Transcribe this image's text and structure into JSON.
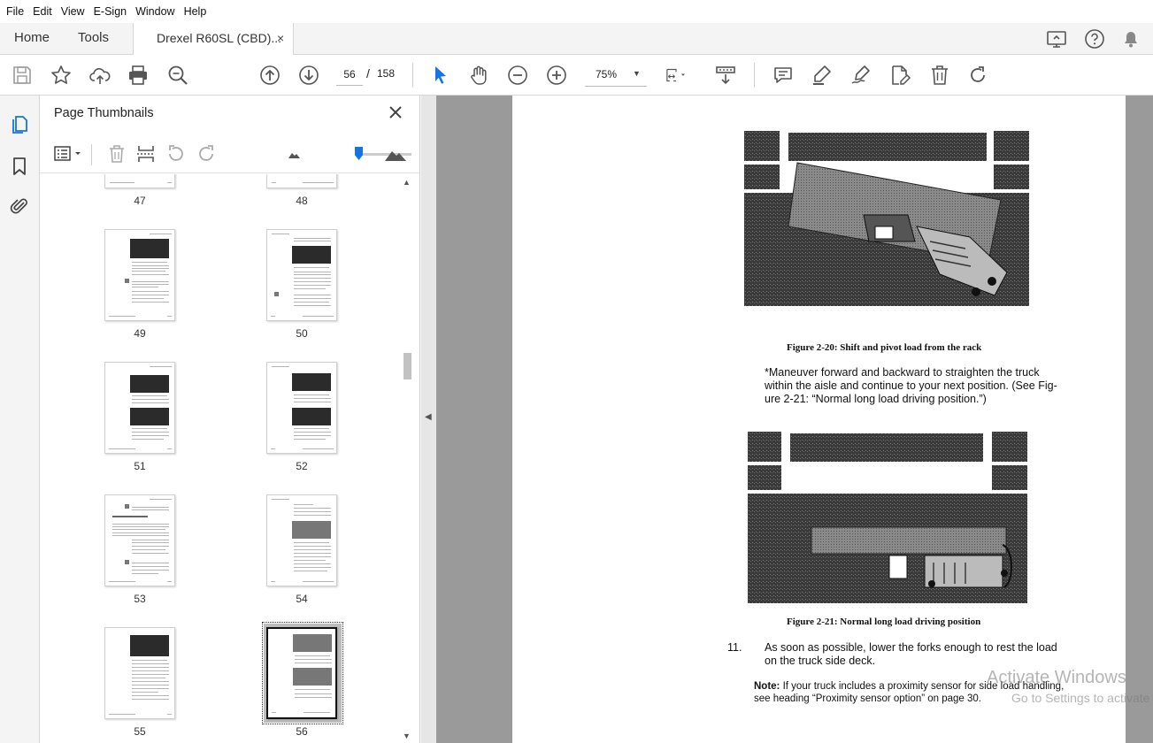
{
  "menu": [
    "File",
    "Edit",
    "View",
    "E-Sign",
    "Window",
    "Help"
  ],
  "tabs": {
    "home": "Home",
    "tools": "Tools",
    "document": "Drexel R60SL (CBD)...",
    "close": "×"
  },
  "toolbar": {
    "page_current": "56",
    "page_separator": "/",
    "page_total": "158",
    "zoom": "75%"
  },
  "panel": {
    "title": "Page Thumbnails",
    "close": "×"
  },
  "thumbnails": [
    {
      "page": "47",
      "selected": false
    },
    {
      "page": "48",
      "selected": false
    },
    {
      "page": "49",
      "selected": false
    },
    {
      "page": "50",
      "selected": false
    },
    {
      "page": "51",
      "selected": false
    },
    {
      "page": "52",
      "selected": false
    },
    {
      "page": "53",
      "selected": false
    },
    {
      "page": "54",
      "selected": false
    },
    {
      "page": "55",
      "selected": false
    },
    {
      "page": "56",
      "selected": true
    }
  ],
  "document": {
    "figure1_caption": "Figure 2-20: Shift and pivot load from the rack",
    "para1": [
      "*Maneuver forward and backward to straighten the truck",
      "within the aisle and continue to your next position.  (See Fig-",
      "ure 2-21: “Normal long load driving position.”)"
    ],
    "figure2_caption": "Figure 2-21: Normal long load driving position",
    "step_number": "11.",
    "step_text": [
      "As soon as possible, lower the forks enough to rest the load",
      "on the truck side deck."
    ],
    "note_label": "Note:",
    "note_line1": " If your truck includes a proximity sensor for side load handling,",
    "note_line2": "see heading “Proximity sensor option” on page 30."
  },
  "watermark": {
    "line1": "Activate Windows",
    "line2": "Go to Settings to activate Windows."
  },
  "colors": {
    "accent": "#1473e6",
    "chrome": "#f4f4f4",
    "doc_bg": "#9a9a9a"
  },
  "icons": {
    "toolbar": [
      "save-icon",
      "star-icon",
      "cloud-upload-icon",
      "print-icon",
      "zoom-search-icon",
      "arrow-up-icon",
      "arrow-down-icon",
      "cursor-icon",
      "hand-icon",
      "zoom-out-icon",
      "zoom-in-icon",
      "fit-page-icon",
      "scroll-mode-icon",
      "comment-icon",
      "highlight-icon",
      "sign-icon",
      "edit-pdf-icon",
      "delete-icon",
      "rotate-icon"
    ],
    "rail": [
      "page-thumbnails-icon",
      "bookmark-icon",
      "attachment-icon"
    ],
    "top_right": [
      "share-screen-icon",
      "help-icon",
      "notification-bell-icon"
    ]
  }
}
